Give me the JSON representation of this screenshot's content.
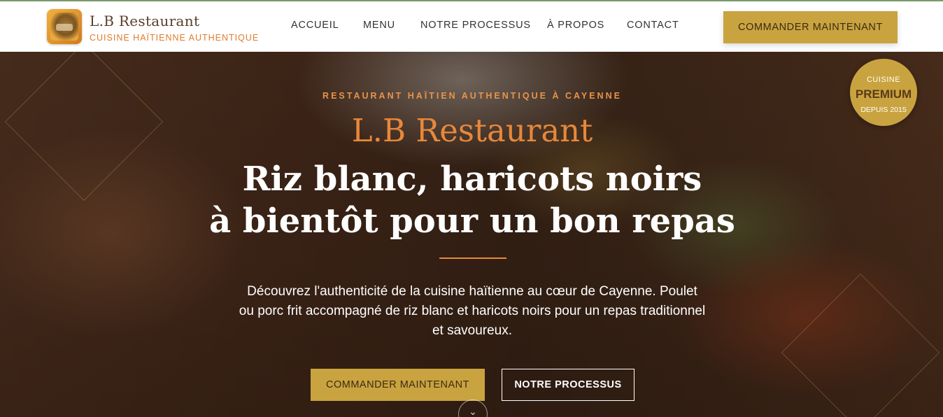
{
  "header": {
    "brand_name": "L.B Restaurant",
    "brand_tagline": "CUISINE HAÏTIENNE AUTHENTIQUE",
    "nav": [
      {
        "label": "ACCUEIL"
      },
      {
        "label": "MENU"
      },
      {
        "label": "NOTRE PROCESSUS"
      },
      {
        "label": "À PROPOS"
      },
      {
        "label": "CONTACT"
      }
    ],
    "cta_label": "COMMANDER MAINTENANT"
  },
  "hero": {
    "kicker": "RESTAURANT HAÏTIEN AUTHENTIQUE À CAYENNE",
    "brand": "L.B Restaurant",
    "title_line1": "Riz blanc, haricots noirs",
    "title_line2": "à bientôt pour un bon repas",
    "description": "Découvrez l'authenticité de la cuisine haïtienne au cœur de Cayenne. Poulet ou porc frit accompagné de riz blanc et haricots noirs pour un repas traditionnel et savoureux.",
    "primary_button": "COMMANDER MAINTENANT",
    "secondary_button": "NOTRE PROCESSUS",
    "scroll_icon": "chevron-down-icon"
  },
  "badge": {
    "line1": "CUISINE",
    "line2": "PREMIUM",
    "line3": "DEPUIS 2015"
  },
  "colors": {
    "accent_gold": "#c9a33f",
    "accent_orange": "#e8883a",
    "brand_brown": "#5a3e2b"
  }
}
